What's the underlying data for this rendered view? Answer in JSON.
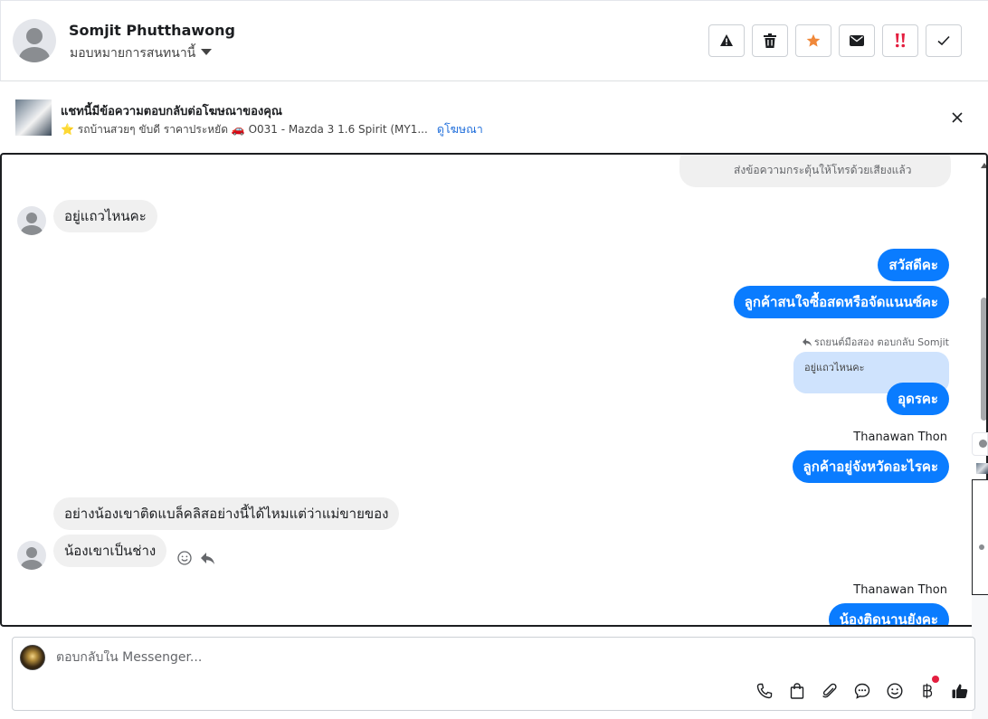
{
  "header": {
    "contact_name": "Somjit Phutthawong",
    "assign_label": "มอบหมายการสนทนานี้",
    "actions": [
      {
        "name": "report-button",
        "icon": "warning-icon"
      },
      {
        "name": "delete-button",
        "icon": "trash-icon"
      },
      {
        "name": "star-button",
        "icon": "star-icon"
      },
      {
        "name": "mark-unread-button",
        "icon": "envelope-icon"
      },
      {
        "name": "priority-button",
        "icon": "double-exclamation-icon"
      },
      {
        "name": "mark-done-button",
        "icon": "check-icon"
      }
    ]
  },
  "ad_banner": {
    "title": "แชทนี้มีข้อความตอบกลับต่อโฆษณาของคุณ",
    "subtitle": "⭐ รถบ้านสวยๆ ขับดี ราคาประหยัด 🚗 O031 - Mazda 3 1.6 Spirit (MY1...",
    "link": "ดูโฆษณา"
  },
  "chat": {
    "top_card_text": "ส่งข้อความกระตุ้นให้โทรด้วยเสียงแล้ว",
    "messages": {
      "m1": "อยู่แถวไหนคะ",
      "m2": "สวัสดีคะ",
      "m3": "ลูกค้าสนใจซื้อสดหรือจัดแนนซ์คะ",
      "reply_meta": "รถยนต์มือสอง ตอบกลับ Somjit",
      "quoted": "อยู่แถวไหนคะ",
      "m4": "อุดรคะ",
      "sender1": "Thanawan Thon",
      "m5": "ลูกค้าอยู่จังหวัดอะไรคะ",
      "m6": "อย่างน้องเขาติดแบล็คลิสอย่างนี้ได้ไหมแต่ว่าแม่ขายของ",
      "m7": "น้องเขาเป็นช่าง",
      "sender2": "Thanawan Thon",
      "m8": "น้องติดนานยังคะ"
    }
  },
  "composer": {
    "placeholder": "ตอบกลับใน Messenger...",
    "tools": [
      "phone-icon",
      "shopping-bag-icon",
      "paperclip-icon",
      "chat-bubble-icon",
      "emoji-icon",
      "baht-icon",
      "thumbs-up-icon"
    ]
  },
  "colors": {
    "accent": "#0a7cff",
    "incoming_bubble": "#f0f0f0",
    "quoted_bubble": "#cfe3fd",
    "star": "#f0883a",
    "priority": "#e41e3f",
    "link": "#216fdb"
  }
}
